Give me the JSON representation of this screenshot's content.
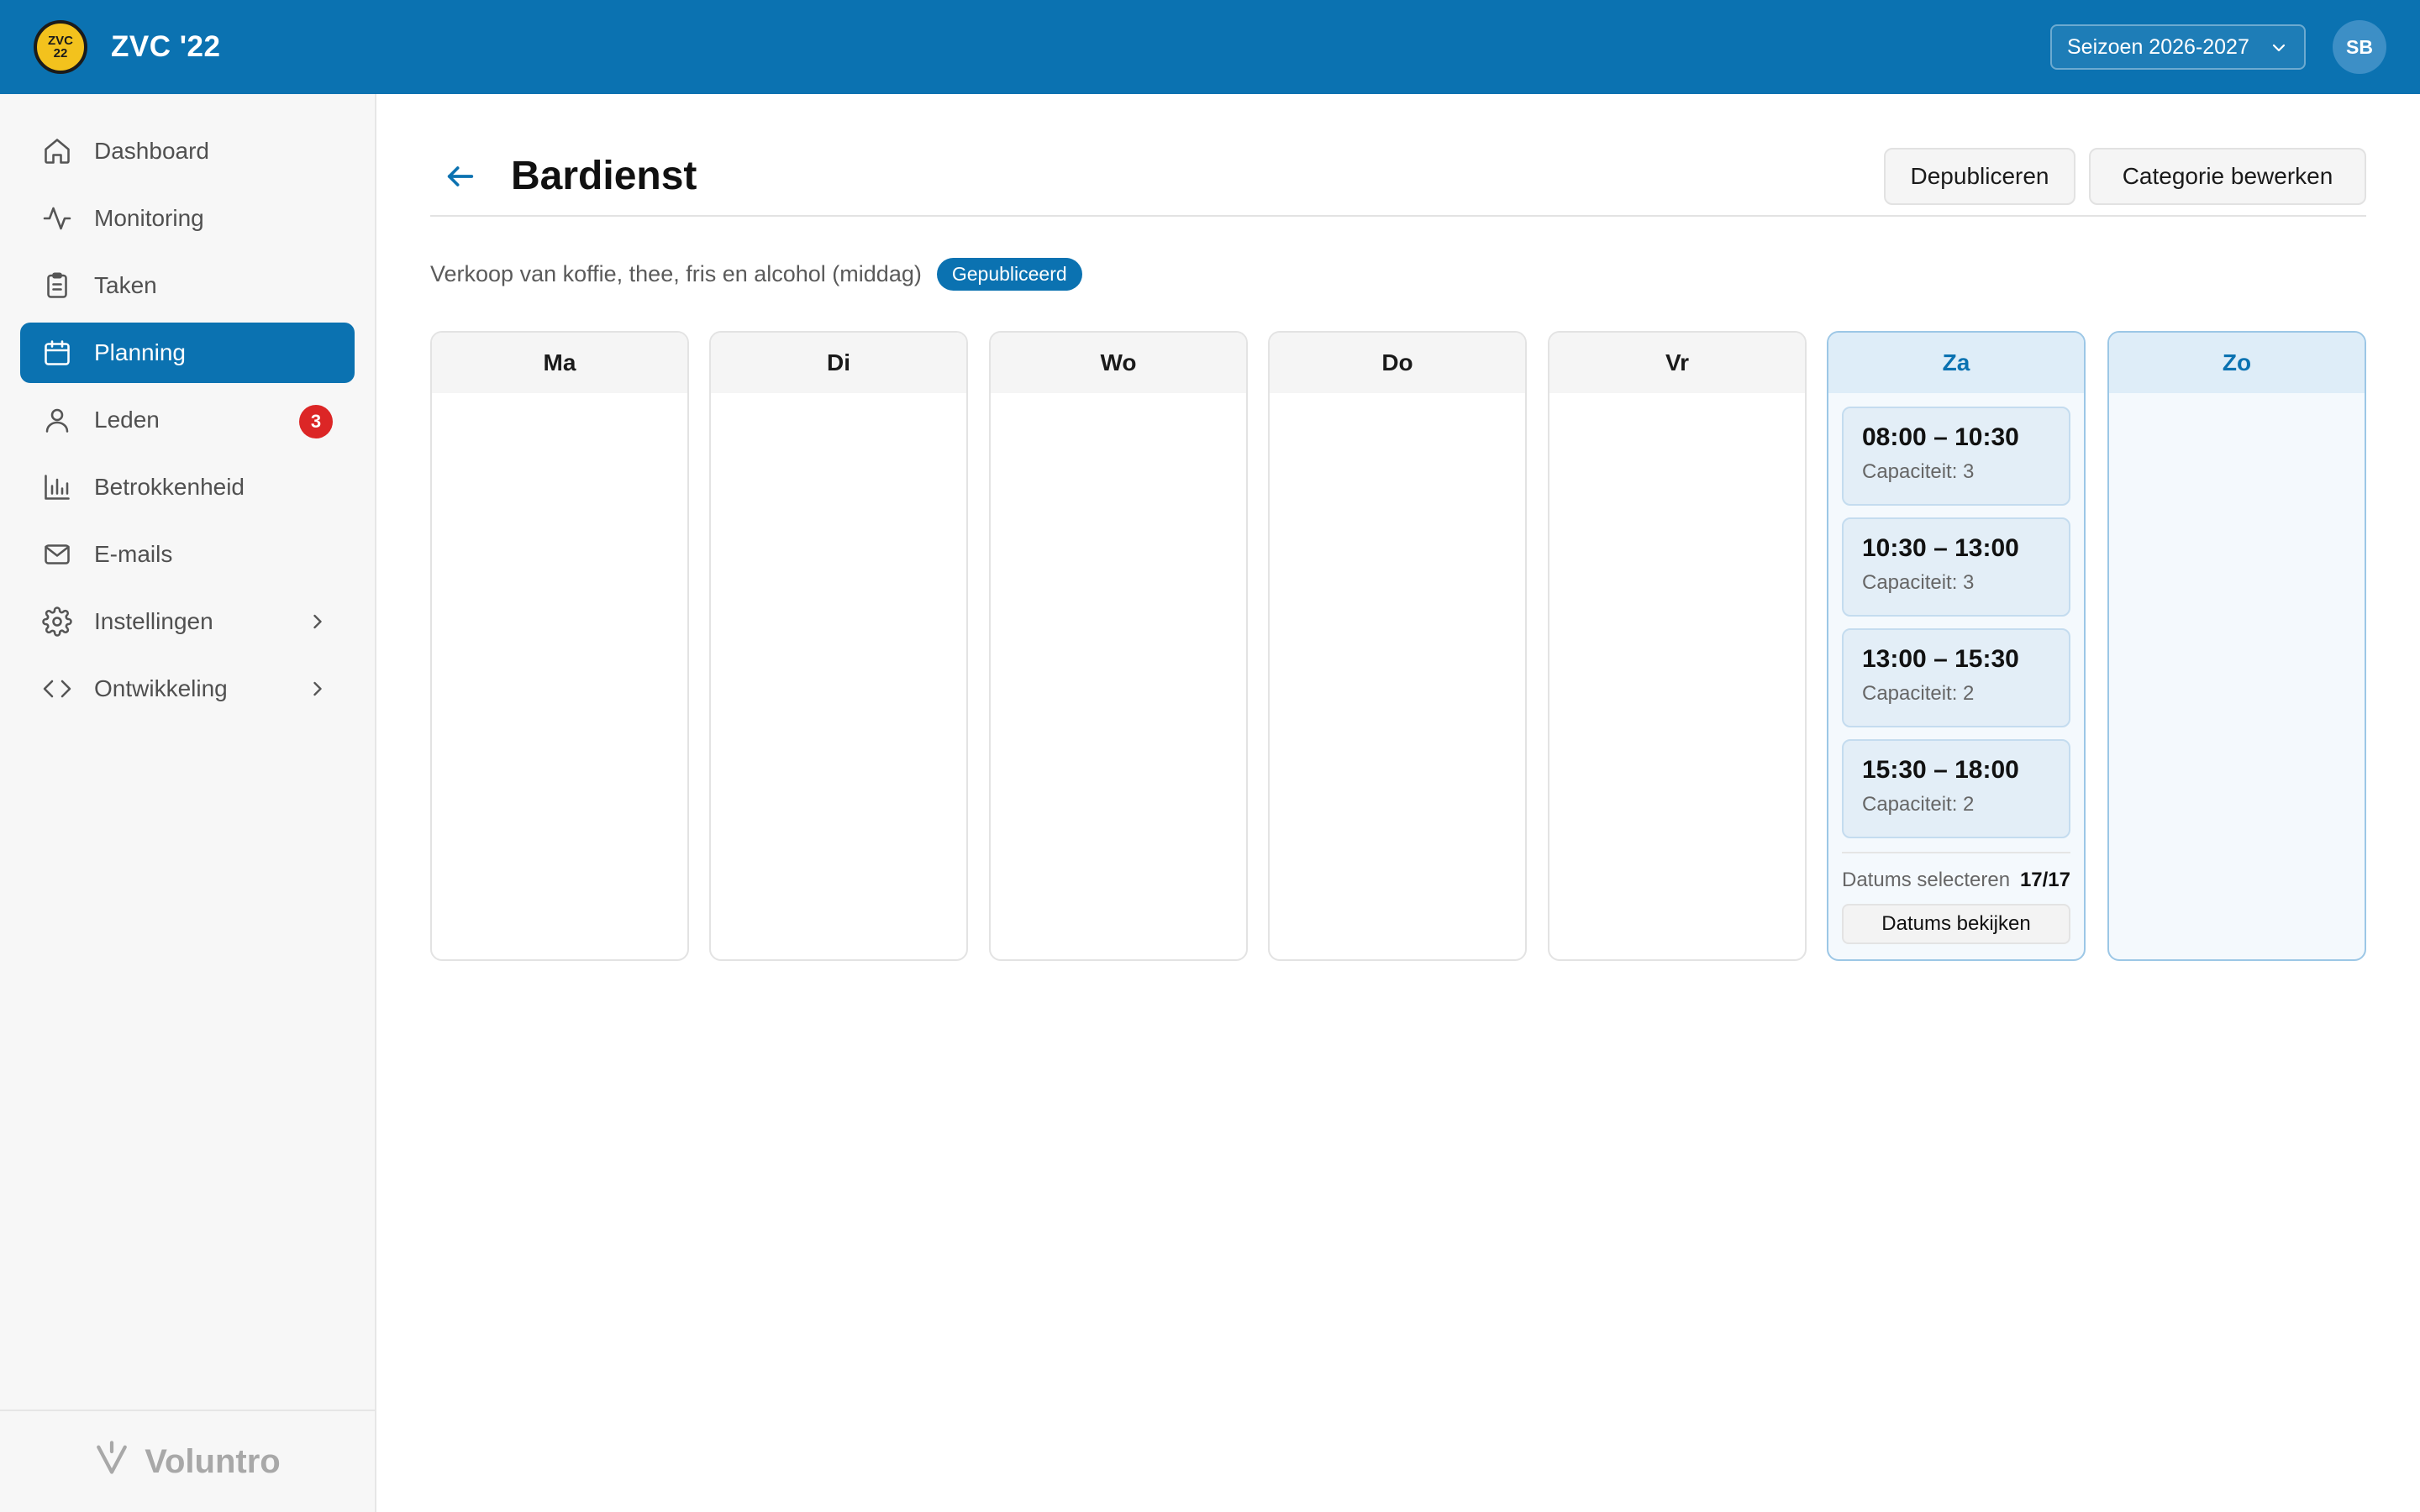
{
  "app": {
    "logo_text": "ZVC '22",
    "title": "ZVC '22",
    "season_label": "Seizoen 2026-2027",
    "user_initials": "SB",
    "brand_color": "#0b72b1"
  },
  "sidebar": {
    "items": [
      {
        "label": "Dashboard",
        "icon": "home-icon"
      },
      {
        "label": "Monitoring",
        "icon": "activity-icon"
      },
      {
        "label": "Taken",
        "icon": "clipboard-icon"
      },
      {
        "label": "Planning",
        "icon": "calendar-icon",
        "active": true
      },
      {
        "label": "Leden",
        "icon": "user-icon",
        "badge": "3"
      },
      {
        "label": "Betrokkenheid",
        "icon": "bar-chart-icon"
      },
      {
        "label": "E-mails",
        "icon": "mail-icon"
      },
      {
        "label": "Instellingen",
        "icon": "gear-icon",
        "expandable": true
      },
      {
        "label": "Ontwikkeling",
        "icon": "code-icon",
        "expandable": true
      }
    ],
    "footer": "Voluntro"
  },
  "page": {
    "title": "Bardienst",
    "unpublish_label": "Depubliceren",
    "edit_label": "Categorie bewerken",
    "description": "Verkoop van koffie, thee, fris en alcohol (middag)",
    "status": "Gepubliceerd"
  },
  "week": {
    "days": [
      "Ma",
      "Di",
      "Wo",
      "Do",
      "Vr",
      "Za",
      "Zo"
    ],
    "saturday": {
      "slots": [
        {
          "time": "08:00 – 10:30",
          "capacity": "Capaciteit: 3"
        },
        {
          "time": "10:30 – 13:00",
          "capacity": "Capaciteit: 3"
        },
        {
          "time": "13:00 – 15:30",
          "capacity": "Capaciteit: 2"
        },
        {
          "time": "15:30 – 18:00",
          "capacity": "Capaciteit: 2"
        }
      ],
      "dates_label": "Datums selecteren",
      "dates_count": "17/17",
      "view_dates_label": "Datums bekijken"
    }
  }
}
